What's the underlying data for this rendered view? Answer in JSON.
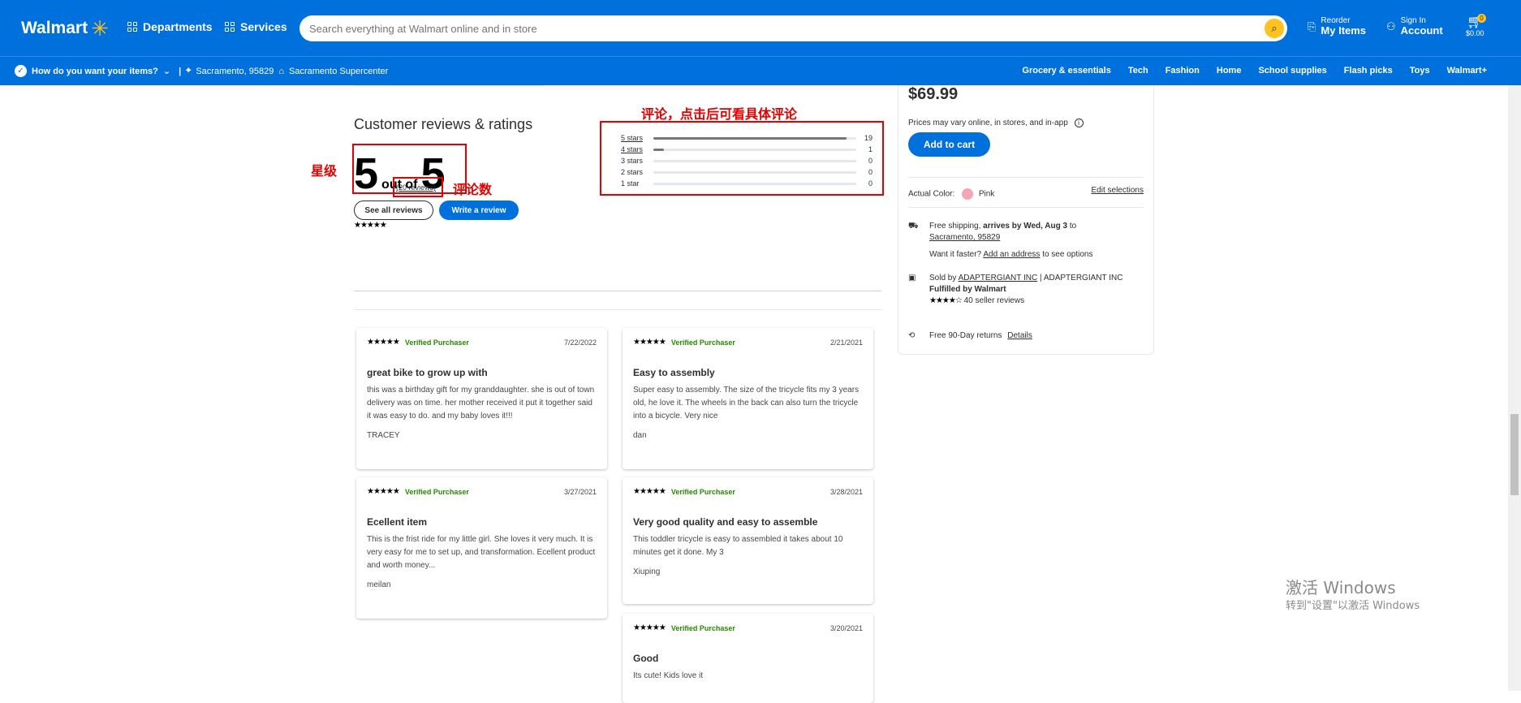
{
  "header": {
    "logo_text": "Walmart",
    "departments": "Departments",
    "services": "Services",
    "search_placeholder": "Search everything at Walmart online and in store",
    "reorder_small": "Reorder",
    "reorder_big": "My Items",
    "signin_small": "Sign In",
    "signin_big": "Account",
    "cart_count": "0",
    "cart_total": "$0.00"
  },
  "subbar": {
    "delivery_prompt": "How do you want your items?",
    "separator": "|",
    "zip": "Sacramento, 95829",
    "store": "Sacramento Supercenter",
    "links": [
      "Grocery & essentials",
      "Tech",
      "Fashion",
      "Home",
      "School supplies",
      "Flash picks",
      "Toys",
      "Walmart+"
    ]
  },
  "annotations": {
    "rating_label": "星级",
    "reviews_count_label": "评论数",
    "histogram_label": "评论，点击后可看具体评论"
  },
  "reviews": {
    "title": "Customer reviews & ratings",
    "score": "5",
    "out_of": "out of",
    "max": "5",
    "stars": "★★★★★",
    "count_link": "(20 reviews)",
    "see_all": "See all reviews",
    "write": "Write a review",
    "histogram": [
      {
        "label": "5 stars",
        "count": "19",
        "fraction": 0.95
      },
      {
        "label": "4 stars",
        "count": "1",
        "fraction": 0.05
      },
      {
        "label": "3 stars",
        "count": "0",
        "fraction": 0
      },
      {
        "label": "2 stars",
        "count": "0",
        "fraction": 0
      },
      {
        "label": "1 star",
        "count": "0",
        "fraction": 0
      }
    ],
    "cards": [
      {
        "stars": "★★★★★",
        "verified": "Verified Purchaser",
        "date": "7/22/2022",
        "title": "great bike to grow up with",
        "body": "this was a birthday gift for my granddaughter. she is out of town delivery was on time. her mother received it put it together said it was easy to do. and my baby loves it!!!",
        "author": "TRACEY"
      },
      {
        "stars": "★★★★★",
        "verified": "Verified Purchaser",
        "date": "2/21/2021",
        "title": "Easy to assembly",
        "body": "Super easy to assembly. The size of the tricycle fits my 3 years old, he love it. The wheels in the back can also turn the tricycle into a bicycle. Very nice",
        "author": "dan"
      },
      {
        "stars": "★★★★★",
        "verified": "Verified Purchaser",
        "date": "3/27/2021",
        "title": "Ecellent item",
        "body": "This is the frist ride for my little girl. She loves it very much. It is very easy for me to set up, and transformation. Ecellent product and worth money...",
        "author": "meilan"
      },
      {
        "stars": "★★★★★",
        "verified": "Verified Purchaser",
        "date": "3/28/2021",
        "title": "Very good quality and easy to assemble",
        "body": "This toddler tricycle is easy to assembled it takes about 10 minutes get it done. My 3",
        "author": "Xiuping"
      },
      {
        "stars": "★★★★★",
        "verified": "Verified Purchaser",
        "date": "3/20/2021",
        "title": "Good",
        "body": "Its cute! Kids love it",
        "author": ""
      }
    ]
  },
  "purchase_panel": {
    "price": "$69.99",
    "price_note": "Prices may vary online, in stores, and in-app",
    "add_to_cart": "Add to cart",
    "color_label": "Actual Color:",
    "color_value": "Pink",
    "edit_selections": "Edit selections",
    "shipping_prefix": "Free shipping,",
    "shipping_bold": "arrives by Wed, Aug 3",
    "shipping_to": "to",
    "shipping_zip": "Sacramento, 95829",
    "faster_prefix": "Want it faster?",
    "faster_link": "Add an address",
    "faster_suffix": "to see options",
    "sold_by": "Sold by",
    "seller_link": "ADAPTERGIANT INC",
    "seller_sep": "|",
    "seller_name": "ADAPTERGIANT INC",
    "fulfilled": "Fulfilled by Walmart",
    "seller_stars": "★★★★☆",
    "seller_reviews": "40 seller reviews",
    "returns": "Free 90-Day returns",
    "returns_link": "Details"
  },
  "watermark": {
    "line1": "激活 Windows",
    "line2": "转到\"设置\"以激活 Windows"
  }
}
